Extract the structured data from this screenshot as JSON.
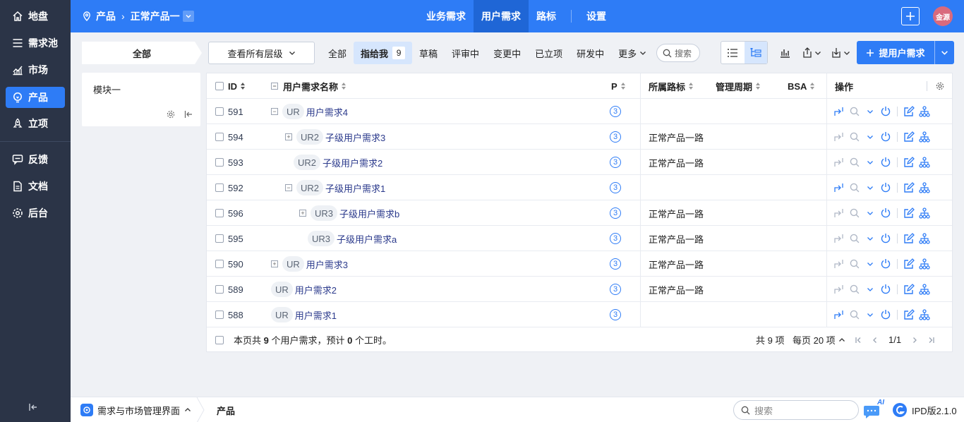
{
  "sidebar": {
    "items": [
      {
        "label": "地盘",
        "icon": "home-icon"
      },
      {
        "label": "需求池",
        "icon": "list-icon"
      },
      {
        "label": "市场",
        "icon": "chart-icon"
      },
      {
        "label": "产品",
        "icon": "bulb-icon",
        "active": true
      },
      {
        "label": "立项",
        "icon": "rocket-icon"
      },
      {
        "label": "反馈",
        "icon": "feedback-icon"
      },
      {
        "label": "文档",
        "icon": "doc-icon"
      },
      {
        "label": "后台",
        "icon": "gear-icon"
      }
    ]
  },
  "header": {
    "breadcrumb_root": "产品",
    "breadcrumb_product": "正常产品一",
    "nav": [
      {
        "label": "业务需求"
      },
      {
        "label": "用户需求",
        "active": true
      },
      {
        "label": "路标"
      },
      {
        "label": "设置"
      }
    ],
    "avatar_text": "金源"
  },
  "toolbar": {
    "scope": "全部",
    "level_select": "查看所有层级",
    "filters": [
      {
        "label": "全部"
      },
      {
        "label": "指给我",
        "count": "9",
        "active": true
      },
      {
        "label": "草稿"
      },
      {
        "label": "评审中"
      },
      {
        "label": "变更中"
      },
      {
        "label": "已立项"
      },
      {
        "label": "研发中"
      },
      {
        "label": "更多"
      }
    ],
    "search_label": "搜索",
    "primary_button": "提用户需求"
  },
  "module": {
    "name": "模块一"
  },
  "table": {
    "headers": {
      "id": "ID",
      "name": "用户需求名称",
      "priority": "P",
      "roadmap": "所属路标",
      "cycle": "管理周期",
      "bsa": "BSA",
      "actions": "操作"
    },
    "rows": [
      {
        "id": "591",
        "tag": "UR",
        "name": "用户需求4",
        "p": "3",
        "road": "",
        "indent": 0,
        "expander": "−",
        "linkActive": true
      },
      {
        "id": "594",
        "tag": "UR2",
        "name": "子级用户需求3",
        "p": "3",
        "road": "正常产品一路",
        "indent": 1,
        "expander": "+",
        "linkActive": false
      },
      {
        "id": "593",
        "tag": "UR2",
        "name": "子级用户需求2",
        "p": "3",
        "road": "正常产品一路",
        "indent": 1,
        "expander": "",
        "linkActive": false
      },
      {
        "id": "592",
        "tag": "UR2",
        "name": "子级用户需求1",
        "p": "3",
        "road": "",
        "indent": 1,
        "expander": "−",
        "linkActive": true
      },
      {
        "id": "596",
        "tag": "UR3",
        "name": "子级用户需求b",
        "p": "3",
        "road": "正常产品一路",
        "indent": 2,
        "expander": "+",
        "linkActive": false
      },
      {
        "id": "595",
        "tag": "UR3",
        "name": "子级用户需求a",
        "p": "3",
        "road": "正常产品一路",
        "indent": 2,
        "expander": "",
        "linkActive": false
      },
      {
        "id": "590",
        "tag": "UR",
        "name": "用户需求3",
        "p": "3",
        "road": "正常产品一路",
        "indent": 0,
        "expander": "+",
        "linkActive": false
      },
      {
        "id": "589",
        "tag": "UR",
        "name": "用户需求2",
        "p": "3",
        "road": "正常产品一路",
        "indent": -1,
        "expander": "",
        "linkActive": false
      },
      {
        "id": "588",
        "tag": "UR",
        "name": "用户需求1",
        "p": "3",
        "road": "",
        "indent": -1,
        "expander": "",
        "linkActive": true
      }
    ],
    "footer": {
      "summary_prefix": "本页共 ",
      "summary_count": "9",
      "summary_mid": " 个用户需求，预计 ",
      "summary_hours": "0",
      "summary_suffix": " 个工时。",
      "total": "共 9 项",
      "per_page": "每页 20 项",
      "page": "1/1"
    }
  },
  "bottombar": {
    "app_name": "需求与市场管理界面",
    "crumb": "产品",
    "search_placeholder": "搜索",
    "ai_label": "AI",
    "version": "IPD版2.1.0"
  },
  "colors": {
    "primary": "#2e7cf6",
    "sidebar": "#2b3447",
    "link": "#2b3a8c"
  }
}
